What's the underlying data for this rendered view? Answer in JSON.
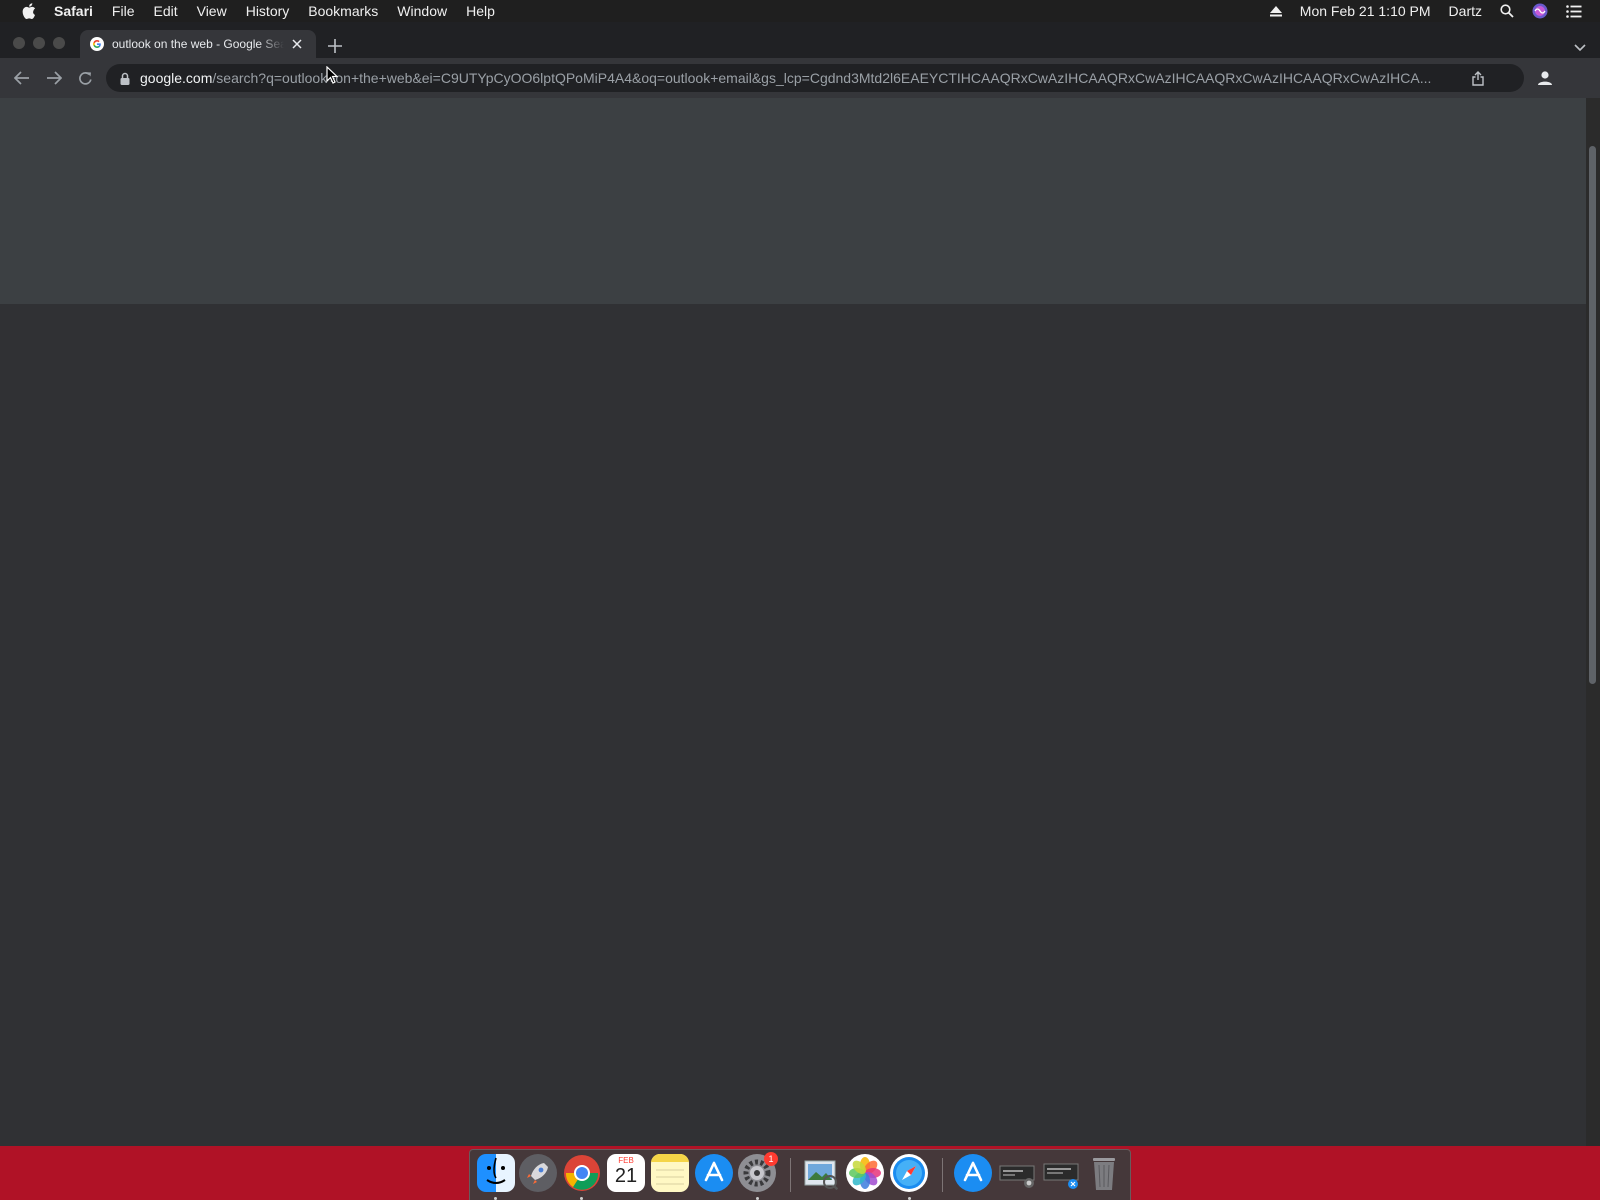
{
  "menubar": {
    "app_name": "Safari",
    "items": [
      "File",
      "Edit",
      "View",
      "History",
      "Bookmarks",
      "Window",
      "Help"
    ],
    "clock": "Mon Feb 21  1:10 PM",
    "user": "Dartz"
  },
  "browser": {
    "tab": {
      "title": "outlook on the web - Google Search",
      "favicon": "google-g-icon"
    },
    "omnibox": {
      "host": "google.com",
      "path": "/search?q=outlook+on+the+web&ei=C9UTYpCyOO6lptQPoMiP4A4&oq=outlook+email&gs_lcp=Cgdnd3Mtd2l6EAEYCTIHCAAQRxCwAzIHCAAQRxCwAzIHCAAQRxCwAzIHCAAQRxCwAzIHCA..."
    }
  },
  "dock": {
    "calendar": {
      "month": "FEB",
      "day": "21"
    },
    "settings_badge": "1",
    "apps": [
      "Finder",
      "Launchpad",
      "Google Chrome",
      "Calendar",
      "Notes",
      "App Store",
      "System Preferences",
      "Preview",
      "Photos",
      "Safari",
      "App Store",
      "Screenshot",
      "Screenshot",
      "Trash"
    ]
  },
  "colors": {
    "menubar_bg": "#1f1f1f",
    "tabstrip_bg": "#202124",
    "toolbar_bg": "#35363a",
    "content_banner": "#3c4043",
    "content_body": "#303134",
    "desktop": "#b01226"
  }
}
